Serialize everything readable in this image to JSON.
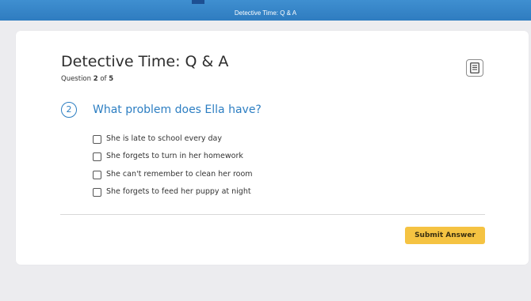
{
  "header": {
    "title": "Detective Time: Q & A"
  },
  "quiz": {
    "title": "Detective Time: Q & A",
    "progress_prefix": "Question ",
    "current": "2",
    "progress_mid": " of ",
    "total": "5"
  },
  "toolbar": {
    "notes_icon": "document-icon"
  },
  "question": {
    "number": "2",
    "text": "What problem does Ella have?",
    "options": [
      {
        "label": "She is late to school every day",
        "checked": false
      },
      {
        "label": "She forgets to turn in her homework",
        "checked": false
      },
      {
        "label": "She can't remember to clean her room",
        "checked": false
      },
      {
        "label": "She forgets to feed her puppy at night",
        "checked": false
      }
    ]
  },
  "actions": {
    "submit_label": "Submit Answer"
  },
  "colors": {
    "header_blue": "#3a87ca",
    "question_blue": "#2c7ec2",
    "submit_yellow": "#f5c342",
    "page_background": "#ececef"
  }
}
